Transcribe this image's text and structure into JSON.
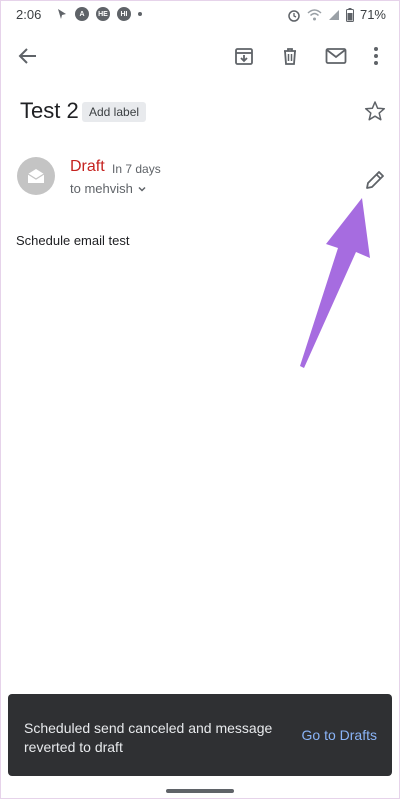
{
  "status_bar": {
    "time": "2:06",
    "battery": "71%",
    "icons": [
      "location-icon",
      "a-badge-icon",
      "notification-icon",
      "notification-icon",
      "dot-icon",
      "alarm-icon",
      "wifi-icon",
      "signal-icon",
      "battery-icon"
    ]
  },
  "toolbar": {
    "icons": [
      "back-arrow-icon",
      "archive-icon",
      "delete-icon",
      "mark-unread-icon",
      "more-vert-icon"
    ]
  },
  "email": {
    "subject": "Test 2",
    "add_label": "Add label",
    "draft_label": "Draft",
    "schedule": "In 7 days",
    "recipient": "to mehvish",
    "body": "Schedule email test"
  },
  "snackbar": {
    "message": "Scheduled send canceled and message reverted to draft",
    "action": "Go to Drafts"
  },
  "colors": {
    "draft": "#c5221f",
    "snackbar_bg": "#2f3033",
    "snackbar_action": "#8ab4f8",
    "annotation_arrow": "#a66ce0"
  }
}
